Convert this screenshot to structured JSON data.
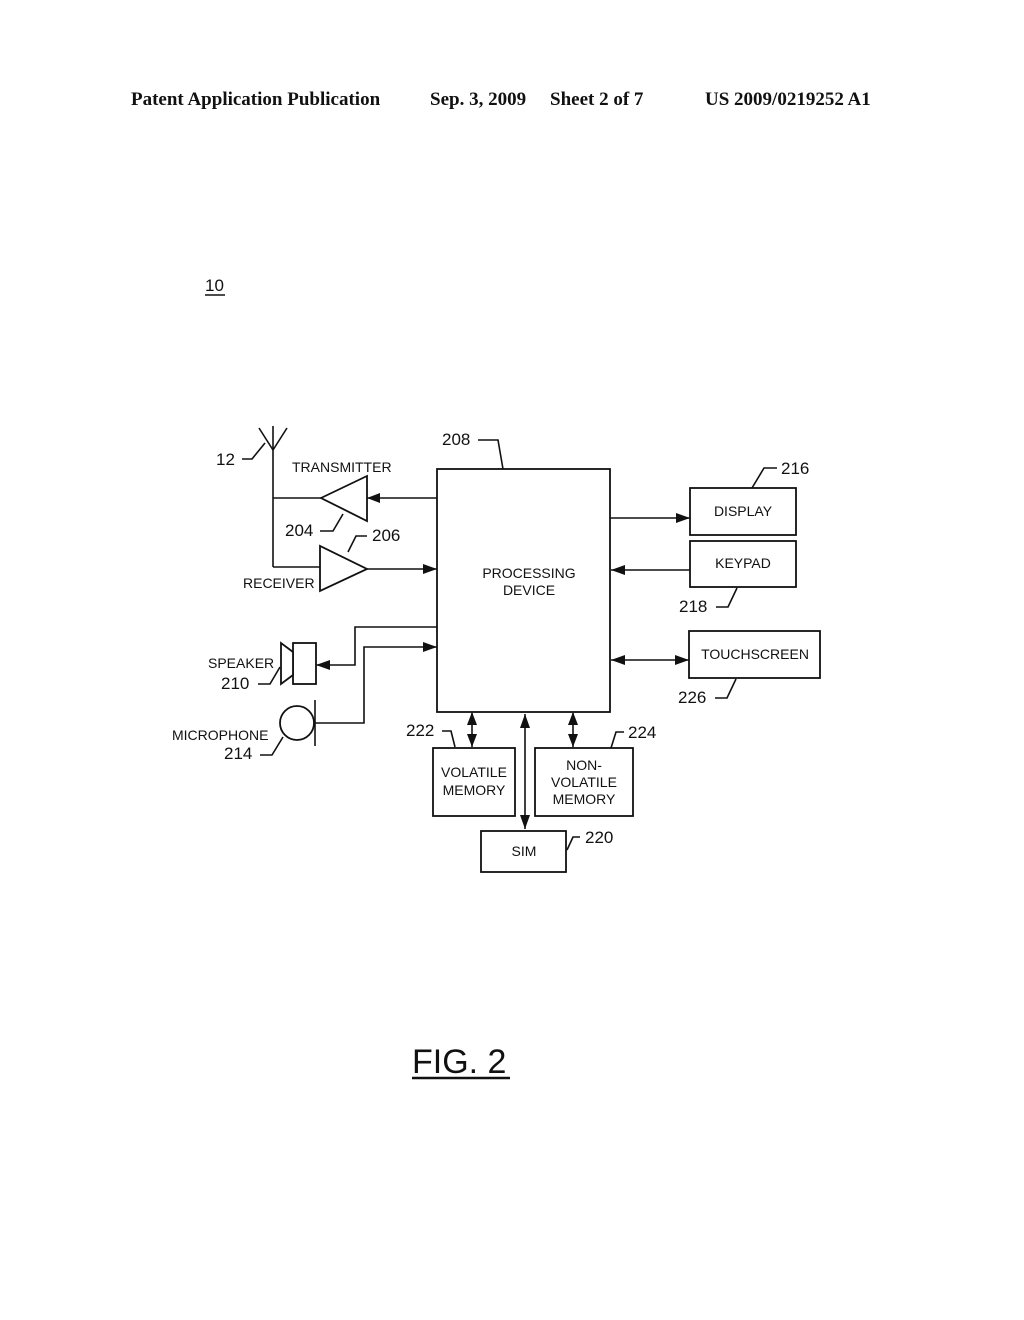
{
  "header": {
    "publication": "Patent Application Publication",
    "date": "Sep. 3, 2009",
    "sheet": "Sheet 2 of 7",
    "number": "US 2009/0219252 A1"
  },
  "figure": {
    "ref_main": "10",
    "caption": "FIG. 2",
    "antenna": {
      "ref": "12"
    },
    "transmitter": {
      "label": "TRANSMITTER",
      "ref": "204"
    },
    "receiver": {
      "label": "RECEIVER",
      "ref": "206"
    },
    "processing": {
      "label_line1": "PROCESSING",
      "label_line2": "DEVICE",
      "ref": "208"
    },
    "speaker": {
      "label": "SPEAKER",
      "ref": "210"
    },
    "microphone": {
      "label": "MICROPHONE",
      "ref": "214"
    },
    "display": {
      "label": "DISPLAY",
      "ref": "216"
    },
    "keypad": {
      "label": "KEYPAD",
      "ref": "218"
    },
    "touchscreen": {
      "label": "TOUCHSCREEN",
      "ref": "226"
    },
    "volatile_memory": {
      "label_line1": "VOLATILE",
      "label_line2": "MEMORY",
      "ref": "222"
    },
    "nonvolatile_memory": {
      "label_line1": "NON-",
      "label_line2": "VOLATILE",
      "label_line3": "MEMORY",
      "ref": "224"
    },
    "sim": {
      "label": "SIM",
      "ref": "220"
    }
  }
}
